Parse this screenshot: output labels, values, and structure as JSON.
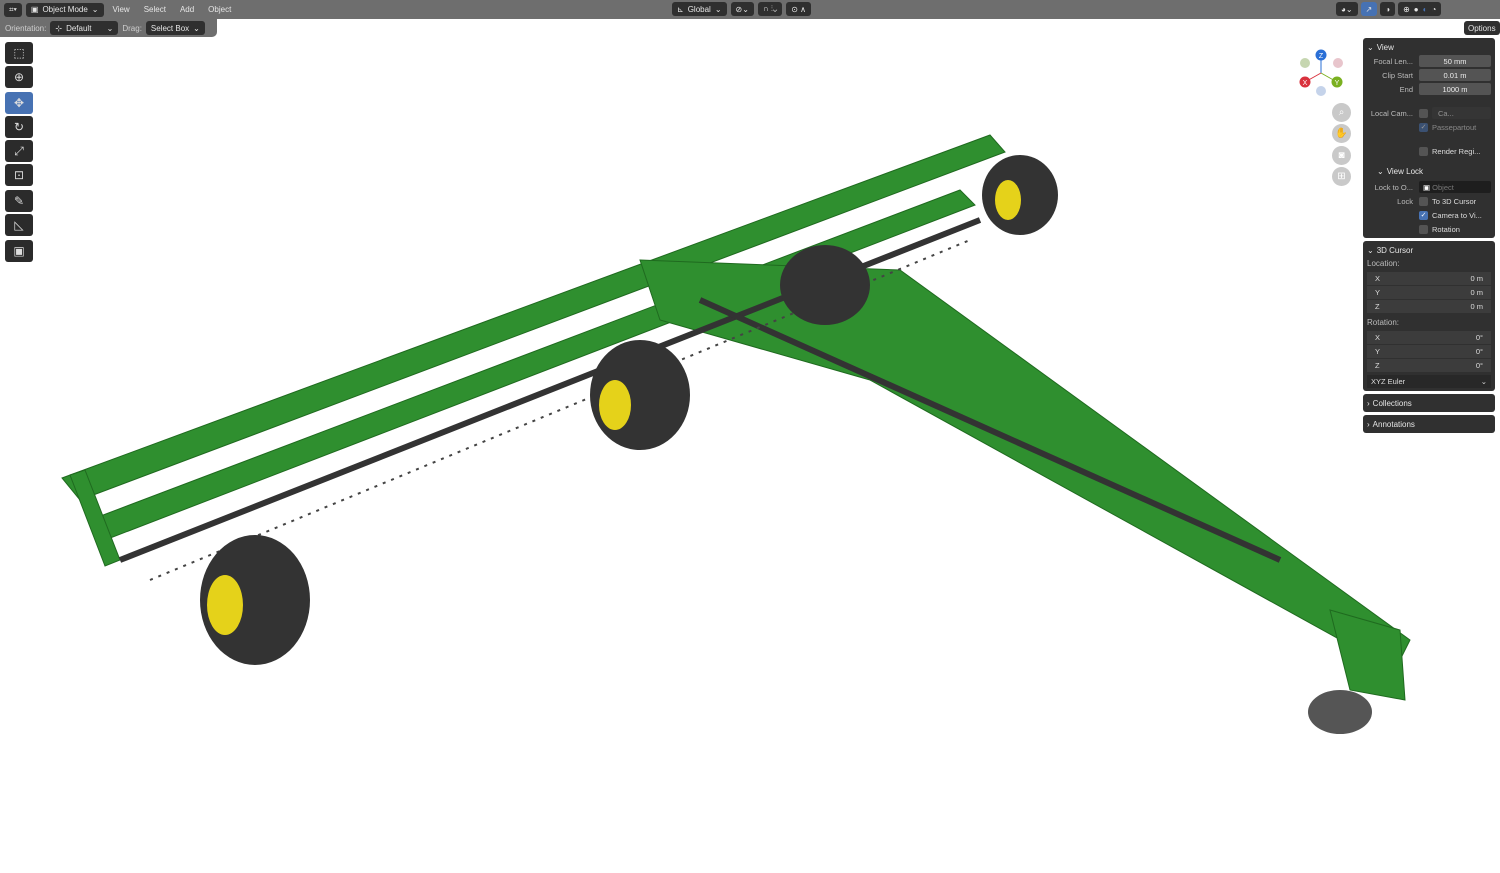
{
  "header": {
    "mode": "Object Mode",
    "menus": [
      "View",
      "Select",
      "Add",
      "Object"
    ],
    "orientation_global": "Global"
  },
  "tool_settings": {
    "orientation_label": "Orientation:",
    "orientation_value": "Default",
    "drag_label": "Drag:",
    "drag_value": "Select Box"
  },
  "options_label": "Options",
  "gizmo": {
    "z": "Z",
    "y": "Y",
    "x": "X"
  },
  "panel": {
    "view": {
      "title": "View",
      "focal_label": "Focal Len...",
      "focal_value": "50 mm",
      "clip_start_label": "Clip Start",
      "clip_start_value": "0.01 m",
      "end_label": "End",
      "end_value": "1000 m",
      "local_cam_label": "Local Cam...",
      "local_cam_value": "Ca...",
      "passepartout": "Passepartout",
      "render_region": "Render Regi..."
    },
    "view_lock": {
      "title": "View Lock",
      "lock_to_label": "Lock to O...",
      "lock_to_placeholder": "Object",
      "lock_label": "Lock",
      "to_cursor": "To 3D Cursor",
      "camera_to_view": "Camera to Vi...",
      "rotation": "Rotation"
    },
    "cursor": {
      "title": "3D Cursor",
      "location_label": "Location:",
      "loc": [
        {
          "axis": "X",
          "value": "0 m"
        },
        {
          "axis": "Y",
          "value": "0 m"
        },
        {
          "axis": "Z",
          "value": "0 m"
        }
      ],
      "rotation_label": "Rotation:",
      "rot": [
        {
          "axis": "X",
          "value": "0°"
        },
        {
          "axis": "Y",
          "value": "0°"
        },
        {
          "axis": "Z",
          "value": "0°"
        }
      ],
      "mode": "XYZ Euler"
    },
    "collections": "Collections",
    "annotations": "Annotations"
  }
}
